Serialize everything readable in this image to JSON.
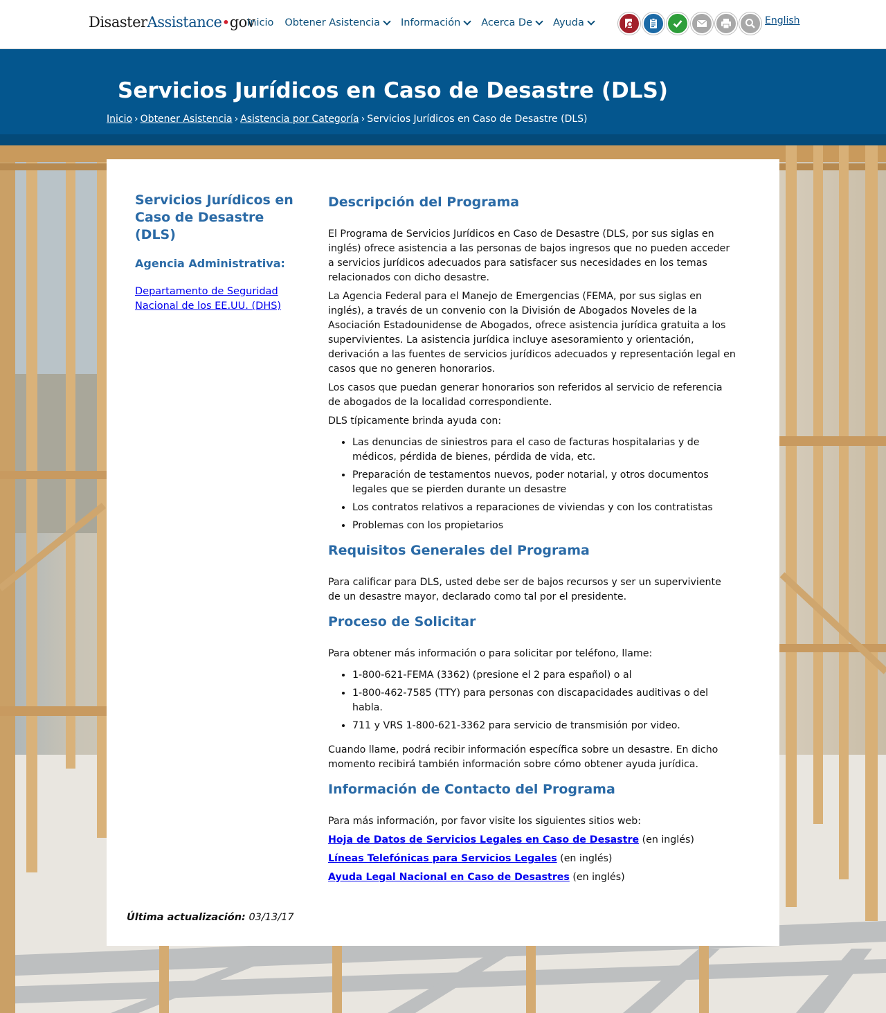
{
  "header": {
    "logo_part1": "Disaster",
    "logo_part2": "Assistance",
    "logo_dot": "•",
    "logo_part3": "gov",
    "nav": [
      {
        "label": "Inicio"
      },
      {
        "label": "Obtener Asistencia"
      },
      {
        "label": "Información"
      },
      {
        "label": "Acerca De"
      },
      {
        "label": "Ayuda"
      }
    ],
    "tools": [
      {
        "icon": "search-document-icon",
        "color": "#a3202b"
      },
      {
        "icon": "clipboard-icon",
        "color": "#1c6aa6"
      },
      {
        "icon": "checkmark-icon",
        "color": "#2e9e3a"
      },
      {
        "icon": "mail-icon",
        "color": "#a8a8a8"
      },
      {
        "icon": "print-icon",
        "color": "#a8a8a8"
      },
      {
        "icon": "search-icon",
        "color": "#a8a8a8"
      }
    ],
    "language_link": "English"
  },
  "banner": {
    "title": "Servicios Jurídicos en Caso de Desastre (DLS)",
    "breadcrumb": [
      "Inicio",
      "Obtener Asistencia",
      "Asistencia por Categoría"
    ],
    "breadcrumb_current": "Servicios Jurídicos en Caso de Desastre (DLS)",
    "separator": "›"
  },
  "sidebar": {
    "title": "Servicios Jurídicos en Caso de Desastre (DLS)",
    "agency_heading": "Agencia Administrativa:",
    "agency_link": "Departamento de Seguridad Nacional de los EE.UU. (DHS)"
  },
  "main": {
    "description": {
      "heading": "Descripción del Programa",
      "p1": "El Programa de Servicios Jurídicos en Caso de Desastre (DLS, por sus siglas en inglés) ofrece asistencia a las personas de bajos ingresos que no pueden acceder a servicios jurídicos adecuados para satisfacer sus necesidades en los temas relacionados con dicho desastre.",
      "p2": "La Agencia Federal para el Manejo de Emergencias (FEMA, por sus siglas en inglés), a través de un convenio con la División de Abogados Noveles de la Asociación Estadounidense de Abogados, ofrece asistencia jurídica gratuita a los supervivientes. La asistencia jurídica incluye asesoramiento y orientación, derivación a las fuentes de servicios jurídicos adecuados y representación legal en casos que no generen honorarios.",
      "p3": "Los casos que puedan generar honorarios son referidos al servicio de referencia de abogados de la localidad correspondiente.",
      "p4": "DLS típicamente brinda ayuda con:",
      "items": [
        "Las denuncias de siniestros para el caso de facturas hospitalarias y de médicos, pérdida de bienes, pérdida de vida, etc.",
        "Preparación de testamentos nuevos, poder notarial, y otros documentos legales que se pierden durante un desastre",
        "Los contratos relativos a reparaciones de viviendas y con los contratistas",
        "Problemas con los propietarios"
      ]
    },
    "requirements": {
      "heading": "Requisitos Generales del Programa",
      "p1": "Para calificar para DLS, usted debe ser de bajos recursos y ser un superviviente de un desastre mayor, declarado como tal por el presidente."
    },
    "process": {
      "heading": "Proceso de Solicitar",
      "p1": "Para obtener más información o para solicitar por teléfono, llame:",
      "items": [
        "1-800-621-FEMA (3362) (presione el 2 para español) o al",
        "1-800-462-7585 (TTY) para personas con discapacidades auditivas o del habla.",
        "711 y VRS 1-800-621-3362 para servicio de transmisión por video."
      ],
      "p2": "Cuando llame, podrá recibir información específica sobre un desastre. En dicho momento recibirá también información sobre cómo obtener ayuda jurídica."
    },
    "contact": {
      "heading": "Información de Contacto del Programa",
      "p1": "Para más información, por favor visite los siguientes sitios web:",
      "links": [
        {
          "label": "Hoja de Datos de Servicios Legales en Caso de Desastre",
          "suffix": " (en inglés)"
        },
        {
          "label": "Líneas Telefónicas para Servicios Legales",
          "suffix": " (en inglés)"
        },
        {
          "label": "Ayuda Legal Nacional en Caso de Desastres",
          "suffix": " (en inglés)"
        }
      ]
    }
  },
  "footer": {
    "updated_label": "Última actualización:",
    "updated_date": "03/13/17"
  }
}
